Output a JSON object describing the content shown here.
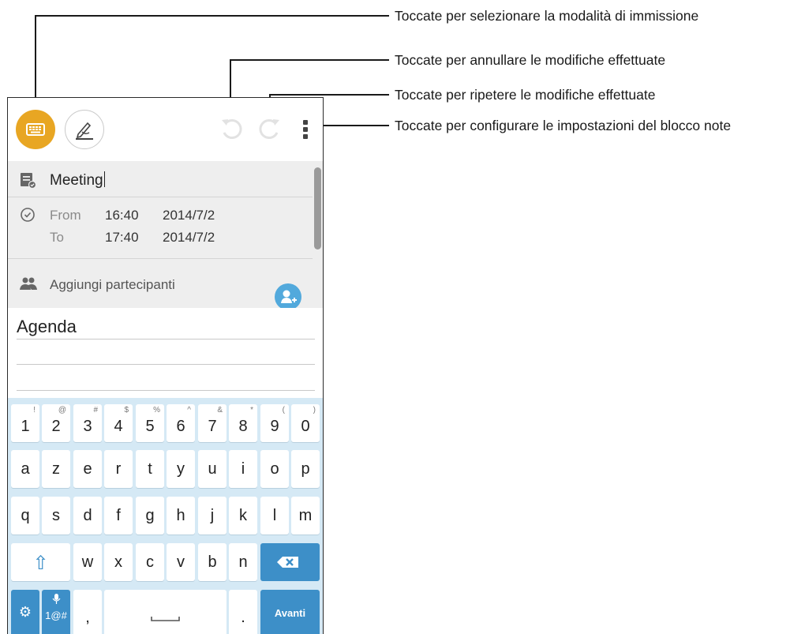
{
  "callouts": [
    {
      "label": "Toccate per selezionare la modalità di immissione"
    },
    {
      "label": "Toccate per annullare le modifiche effettuate"
    },
    {
      "label": "Toccate per ripetere le modifiche effettuate"
    },
    {
      "label": "Toccate per configurare le impostazioni del blocco note"
    }
  ],
  "toolbar": {
    "icons": [
      "keyboard-icon",
      "handwriting-pen-icon",
      "undo-icon",
      "redo-icon",
      "more-vert-icon"
    ],
    "accent": "#e8a623"
  },
  "form": {
    "title_value": "Meeting",
    "from_label": "From",
    "from_time": "16:40",
    "from_date": "2014/7/2",
    "to_label": "To",
    "to_time": "17:40",
    "to_date": "2014/7/2",
    "participants_label": "Aggiungi partecipanti"
  },
  "notes": {
    "heading": "Agenda"
  },
  "keyboard": {
    "number_row": [
      {
        "main": "1",
        "alt": "!"
      },
      {
        "main": "2",
        "alt": "@"
      },
      {
        "main": "3",
        "alt": "#"
      },
      {
        "main": "4",
        "alt": "$"
      },
      {
        "main": "5",
        "alt": "%"
      },
      {
        "main": "6",
        "alt": "^"
      },
      {
        "main": "7",
        "alt": "&"
      },
      {
        "main": "8",
        "alt": "*"
      },
      {
        "main": "9",
        "alt": "("
      },
      {
        "main": "0",
        "alt": ")"
      }
    ],
    "row1": [
      "a",
      "z",
      "e",
      "r",
      "t",
      "y",
      "u",
      "i",
      "o",
      "p"
    ],
    "row2": [
      "q",
      "s",
      "d",
      "f",
      "g",
      "h",
      "j",
      "k",
      "l",
      "m"
    ],
    "row3": [
      "w",
      "x",
      "c",
      "v",
      "b",
      "n"
    ],
    "shift_symbol": "⇧",
    "backspace_symbol": "⌫",
    "settings_symbol": "⚙",
    "symbols_label": "1@#",
    "comma": ",",
    "space_symbol": "␣",
    "period": ".",
    "enter_label": "Avanti",
    "key_color": "#ffffff",
    "action_color": "#3d8fc8",
    "bg_color": "#d5e9f5"
  }
}
